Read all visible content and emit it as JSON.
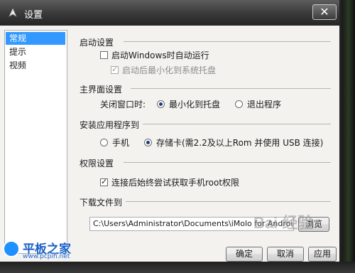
{
  "window": {
    "title": "设置",
    "close_label": "✕"
  },
  "nav": {
    "items": [
      "常规",
      "提示",
      "视频"
    ],
    "selected_index": 0
  },
  "startup": {
    "title": "启动设置",
    "auto_start_label": "启动Windows时自动运行",
    "auto_start_checked": false,
    "minimize_tray_label": "启动后最小化到系统托盘",
    "minimize_tray_checked": true
  },
  "main_ui": {
    "title": "主界面设置",
    "close_label": "关闭窗口时:",
    "option_minimize": "最小化到托盘",
    "option_exit": "退出程序",
    "selected": "minimize"
  },
  "install": {
    "title": "安装应用程序到",
    "option_phone": "手机",
    "option_sd": "存储卡(需2.2及以上Rom 并使用 USB 连接)",
    "selected": "sd"
  },
  "permission": {
    "title": "权限设置",
    "root_label": "连接后始终尝试获取手机root权限",
    "root_checked": true
  },
  "download": {
    "title": "下载文件到",
    "path": "C:\\Users\\Administrator\\Documents\\iMolo for Android\\",
    "browse_label": "浏览"
  },
  "footer": {
    "ok_label": "确定",
    "cancel_label": "取消",
    "apply_label": "应用"
  },
  "watermarks": {
    "baidu": "Bai 经验",
    "site_title": "平板之家",
    "site_url": "www.pcpih.net"
  },
  "colors": {
    "selection": "#3399ff",
    "titlebar": "#3b3b3b"
  }
}
